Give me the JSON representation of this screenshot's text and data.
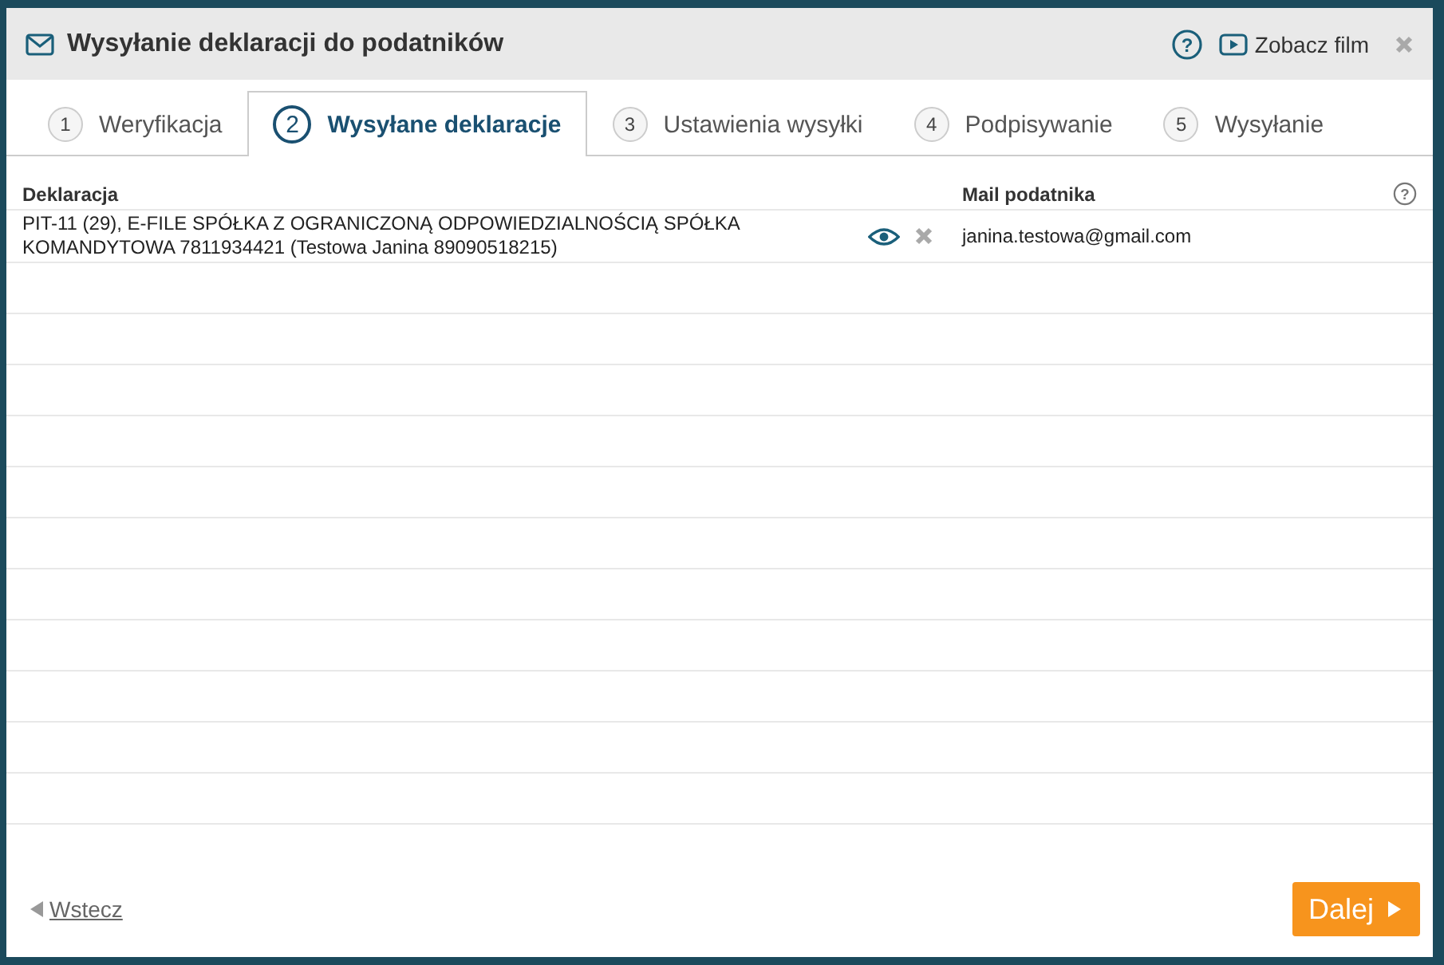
{
  "window": {
    "title": "Wysyłanie deklaracji do podatników",
    "video_link": "Zobacz film",
    "help": "?"
  },
  "tabs": [
    {
      "number": "1",
      "label": "Weryfikacja",
      "selected": false
    },
    {
      "number": "2",
      "label": "Wysyłane deklaracje",
      "selected": true
    },
    {
      "number": "3",
      "label": "Ustawienia wysyłki",
      "selected": false
    },
    {
      "number": "4",
      "label": "Podpisywanie",
      "selected": false
    },
    {
      "number": "5",
      "label": "Wysyłanie",
      "selected": false
    }
  ],
  "table": {
    "help": "?",
    "columns": [
      "Deklaracja",
      "Mail podatnika"
    ],
    "rows": [
      {
        "declaration": "PIT-11 (29), E-FILE SPÓŁKA Z OGRANICZONĄ ODPOWIEDZIALNOŚCIĄ SPÓŁKA KOMANDYTOWA 7811934421 (Testowa Janina 89090518215)",
        "email": "janina.testowa@gmail.com"
      }
    ]
  },
  "footer": {
    "back": "Wstecz",
    "next": "Dalej"
  }
}
